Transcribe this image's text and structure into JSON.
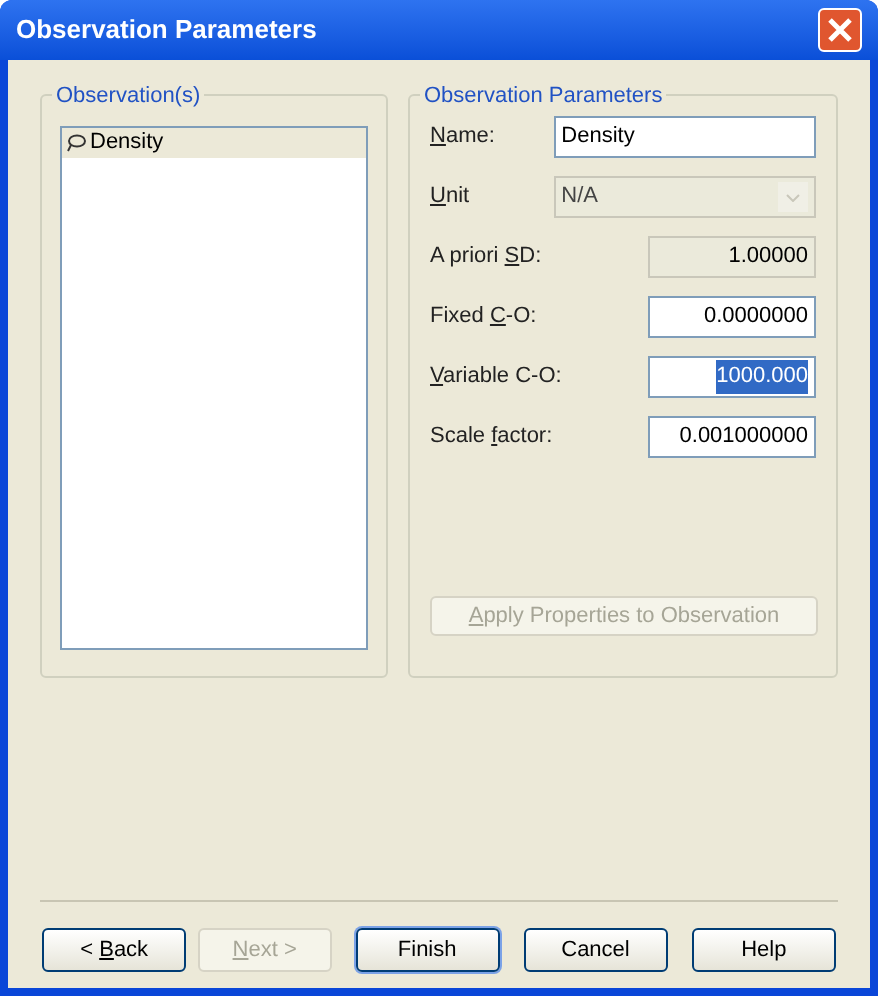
{
  "window": {
    "title": "Observation Parameters"
  },
  "observations": {
    "title": "Observation(s)",
    "items": [
      {
        "label": "Density",
        "selected": true
      }
    ]
  },
  "parameters": {
    "title": "Observation Parameters",
    "fields": [
      {
        "kind": "text",
        "label": {
          "key": "N",
          "after": "ame:"
        },
        "value": "Density",
        "disabled": false,
        "highlighted": false
      },
      {
        "kind": "combo",
        "label": {
          "key": "U",
          "after": "nit"
        },
        "value": "N/A",
        "disabled": true,
        "highlighted": false
      },
      {
        "kind": "number",
        "label": {
          "before": "A priori ",
          "key": "S",
          "after": "D:"
        },
        "value": "1.00000",
        "disabled": true,
        "highlighted": false
      },
      {
        "kind": "number",
        "label": {
          "before": "Fixed ",
          "key": "C",
          "after": "-O:"
        },
        "value": "0.0000000",
        "disabled": false,
        "highlighted": false
      },
      {
        "kind": "number",
        "label": {
          "key": "V",
          "after": "ariable C-O:"
        },
        "value": "1000.000",
        "disabled": false,
        "highlighted": true
      },
      {
        "kind": "number",
        "label": {
          "before": "Scale ",
          "key": "f",
          "after": "actor:"
        },
        "value": "0.001000000",
        "disabled": false,
        "highlighted": false
      }
    ],
    "apply_button": {
      "label": {
        "key": "A",
        "after": "pply Properties to Observation"
      },
      "disabled": true
    }
  },
  "buttons": [
    {
      "label": {
        "before": "< ",
        "key": "B",
        "after": "ack"
      },
      "disabled": false,
      "default": false
    },
    {
      "label": {
        "key": "N",
        "after": "ext >"
      },
      "disabled": true,
      "default": false
    },
    {
      "label": {
        "before": "Finish"
      },
      "disabled": false,
      "default": true
    },
    {
      "label": {
        "before": "Cancel"
      },
      "disabled": false,
      "default": false
    },
    {
      "label": {
        "before": "Help"
      },
      "disabled": false,
      "default": false
    }
  ]
}
